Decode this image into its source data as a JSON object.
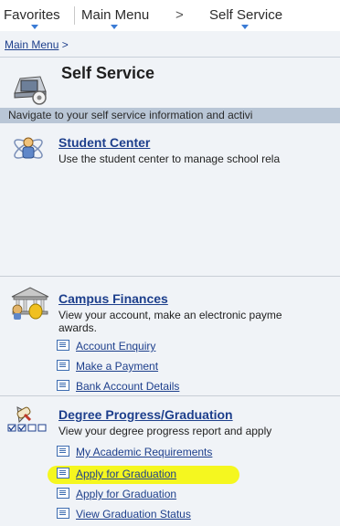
{
  "topnav": {
    "favorites": "Favorites",
    "main_menu": "Main Menu",
    "separator": ">",
    "self_service": "Self Service"
  },
  "breadcrumb": {
    "link": "Main Menu",
    "separator": ">"
  },
  "page": {
    "title": "Self Service",
    "subtitle": "Navigate to your self service information and activi"
  },
  "sections": {
    "student_center": {
      "title": "Student Center",
      "desc": "Use the student center to manage school rela"
    },
    "campus_finances": {
      "title": "Campus Finances",
      "desc_line1": "View your account, make an electronic payme",
      "desc_line2": "awards.",
      "links": [
        "Account Enquiry",
        "Make a Payment",
        "Bank Account Details"
      ]
    },
    "degree_progress": {
      "title": "Degree Progress/Graduation",
      "desc": "View your degree progress report and apply",
      "links": [
        "My Academic Requirements",
        "Apply for Graduation",
        "Apply for Graduation",
        "View Graduation Status"
      ]
    }
  },
  "colors": {
    "link": "#1d3f8c",
    "highlight": "#f5f71f",
    "bar": "#b9c6d6",
    "pane": "#f0f3f7"
  },
  "icons": [
    "chevron-down-icon",
    "self-service-icon",
    "student-center-icon",
    "campus-finances-icon",
    "degree-progress-icon",
    "list-item-icon"
  ]
}
